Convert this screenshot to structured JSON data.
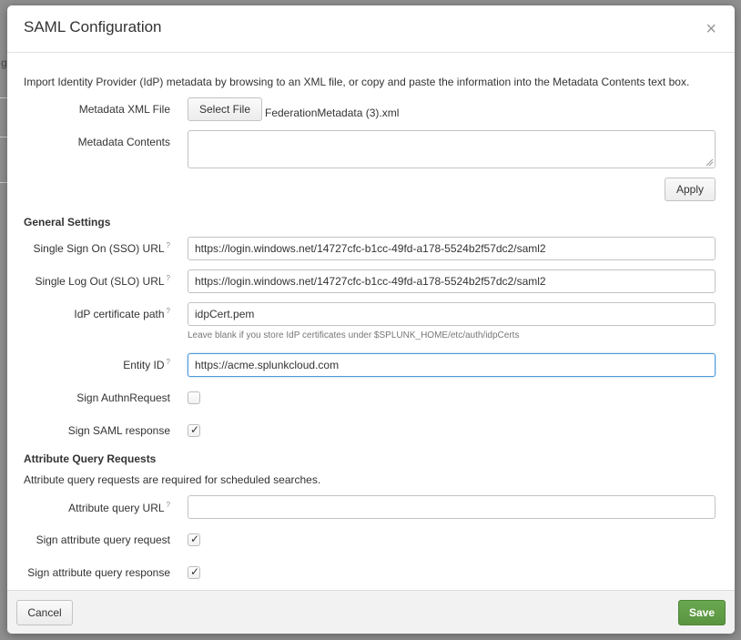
{
  "background": {
    "partial_text": "g"
  },
  "modal": {
    "title": "SAML Configuration",
    "close_glyph": "×",
    "intro": "Import Identity Provider (IdP) metadata by browsing to an XML file, or copy and paste the information into the Metadata Contents text box.",
    "metadata_file": {
      "label": "Metadata XML File",
      "button_label": "Select File",
      "file_name": "FederationMetadata (3).xml"
    },
    "metadata_contents": {
      "label": "Metadata Contents",
      "value": ""
    },
    "apply_label": "Apply",
    "general_settings": {
      "title": "General Settings",
      "sso_url": {
        "label": "Single Sign On (SSO) URL",
        "help": "?",
        "value": "https://login.windows.net/14727cfc-b1cc-49fd-a178-5524b2f57dc2/saml2"
      },
      "slo_url": {
        "label": "Single Log Out (SLO) URL",
        "help": "?",
        "value": "https://login.windows.net/14727cfc-b1cc-49fd-a178-5524b2f57dc2/saml2"
      },
      "idp_cert_path": {
        "label": "IdP certificate path",
        "help": "?",
        "value": "idpCert.pem",
        "hint": "Leave blank if you store IdP certificates under $SPLUNK_HOME/etc/auth/idpCerts"
      },
      "entity_id": {
        "label": "Entity ID",
        "help": "?",
        "value": "https://acme.splunkcloud.com"
      },
      "sign_authn_request": {
        "label": "Sign AuthnRequest",
        "checked": false
      },
      "sign_saml_response": {
        "label": "Sign SAML response",
        "checked": true
      }
    },
    "attribute_query": {
      "title": "Attribute Query Requests",
      "description": "Attribute query requests are required for scheduled searches.",
      "url": {
        "label": "Attribute query URL",
        "help": "?",
        "value": ""
      },
      "sign_request": {
        "label": "Sign attribute query request",
        "checked": true
      },
      "sign_response": {
        "label": "Sign attribute query response",
        "checked": true
      }
    },
    "check_glyph": "✓",
    "footer": {
      "cancel_label": "Cancel",
      "save_label": "Save"
    }
  },
  "colors": {
    "save_green": "#5e9b45",
    "focus_blue": "#4f9ad8"
  }
}
